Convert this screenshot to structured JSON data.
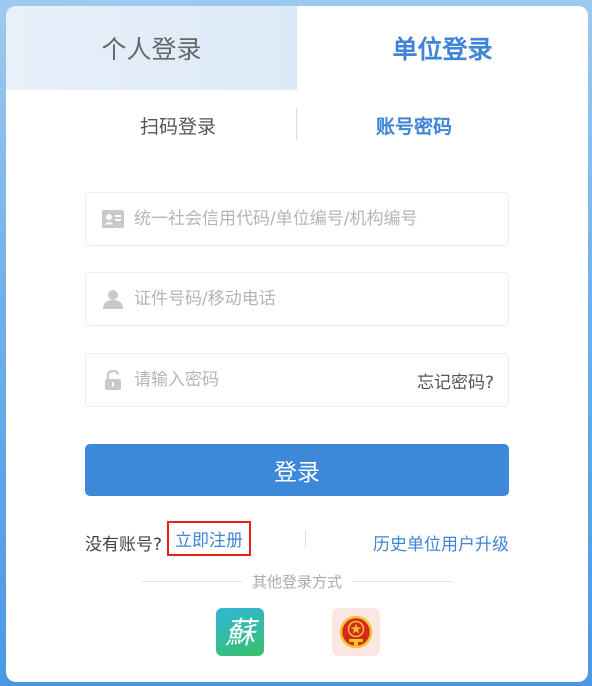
{
  "tabs": {
    "personal_label": "个人登录",
    "unit_label": "单位登录"
  },
  "sub_tabs": {
    "qr_label": "扫码登录",
    "account_label": "账号密码"
  },
  "form": {
    "credit_code_placeholder": "统一社会信用代码/单位编号/机构编号",
    "credit_code_value": "",
    "id_phone_placeholder": "证件号码/移动电话",
    "id_phone_value": "",
    "password_placeholder": "请输入密码",
    "password_value": "",
    "forgot_label": "忘记密码?",
    "login_label": "登录"
  },
  "links": {
    "no_account_label": "没有账号?",
    "register_label": "立即注册",
    "upgrade_label": "历史单位用户升级"
  },
  "other_login": {
    "label": "其他登录方式",
    "su_glyph": "蘇",
    "icons": [
      "su-service-icon",
      "national-emblem-icon"
    ]
  },
  "colors": {
    "accent": "#3f84d6",
    "button": "#3d88d8",
    "highlight_border": "#e8201a"
  }
}
